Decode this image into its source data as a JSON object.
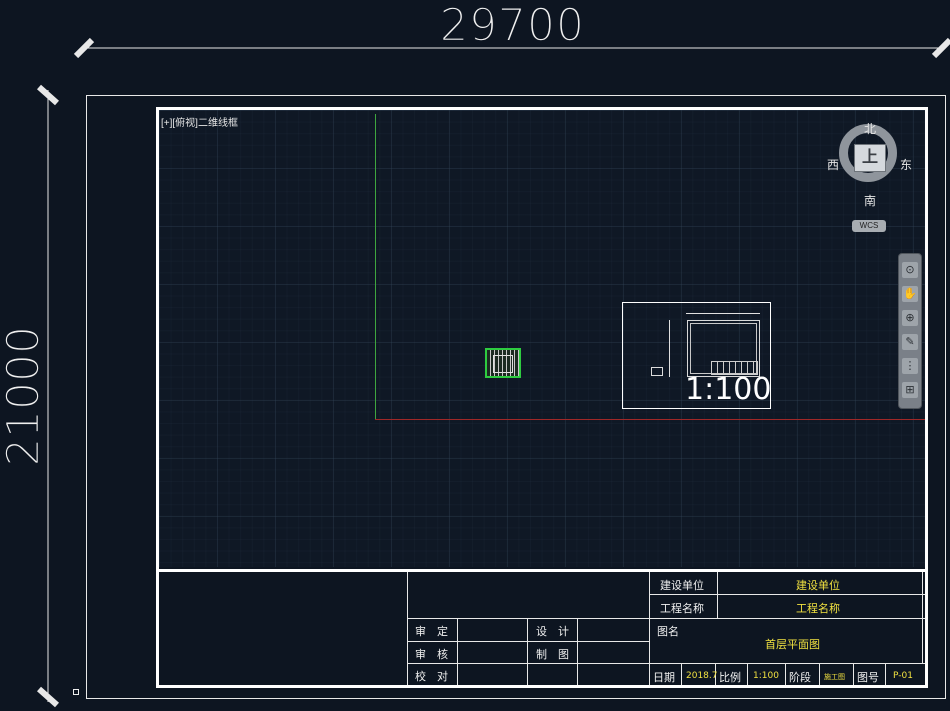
{
  "dimensions": {
    "width_label": "29700",
    "height_label": "21000"
  },
  "viewport": {
    "label": "[+][俯视]二维线框"
  },
  "viewcube": {
    "face": "上",
    "north": "北",
    "south": "南",
    "west": "西",
    "east": "东",
    "wcs": "WCS"
  },
  "nav_bar": {
    "buttons": [
      "⊙",
      "✋",
      "⊕",
      "✎",
      "⋮",
      "⊞"
    ]
  },
  "sheet_preview": {
    "scale": "1:100"
  },
  "title_block": {
    "client_label": "建设单位",
    "client_value": "建设单位",
    "project_label": "工程名称",
    "project_value": "工程名称",
    "drawing_name_label": "图名",
    "drawing_name_value": "首层平面图",
    "approve_label": "审　定",
    "review_label": "审　核",
    "check_label": "校　对",
    "design_label": "设　计",
    "draft_label": "制　图",
    "date_label": "日期",
    "date_value": "2018.7",
    "scale_label": "比例",
    "scale_value": "1:100",
    "stage_label": "阶段",
    "stage_value": "施工图",
    "number_label": "图号",
    "number_value": "P-01"
  }
}
